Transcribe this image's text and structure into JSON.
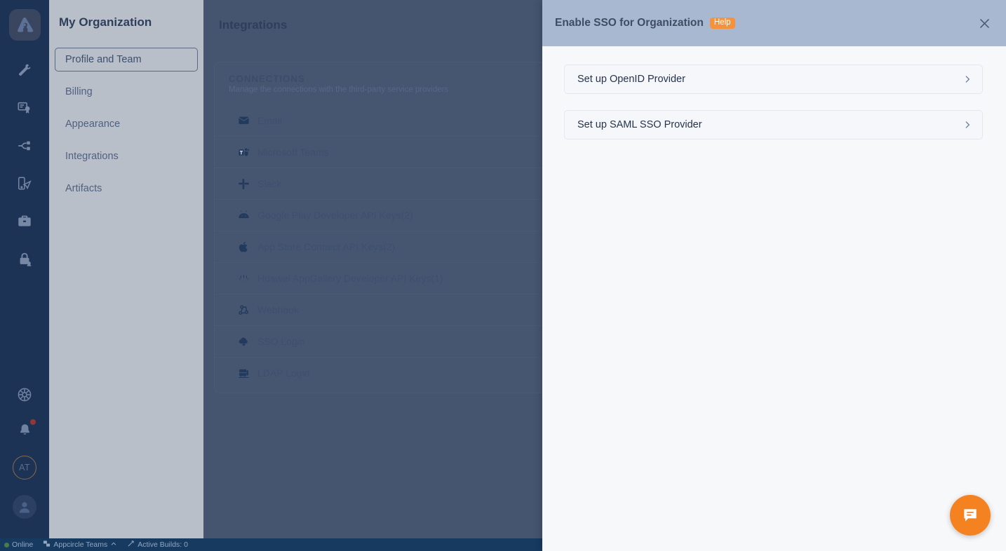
{
  "rail": {
    "logo": "appcircle-logo",
    "items": [
      {
        "name": "build-icon",
        "label": "Build"
      },
      {
        "name": "signing-identities-icon",
        "label": "Signing Identities"
      },
      {
        "name": "distribute-icon",
        "label": "Distribute"
      },
      {
        "name": "testing-distribution-icon",
        "label": "Testing Distribution"
      },
      {
        "name": "enterprise-store-icon",
        "label": "Enterprise App Store"
      },
      {
        "name": "publish-lock-icon",
        "label": "Publish"
      }
    ],
    "bottom": [
      {
        "name": "settings-gear-icon",
        "label": "Settings"
      },
      {
        "name": "notifications-bell-icon",
        "label": "Notifications",
        "has_badge": true
      },
      {
        "name": "organization-avatar",
        "label": "AT"
      },
      {
        "name": "user-avatar",
        "label": "Account"
      }
    ]
  },
  "orgnav": {
    "title": "My Organization",
    "items": [
      {
        "label": "Profile and Team",
        "selected": true
      },
      {
        "label": "Billing",
        "selected": false
      },
      {
        "label": "Appearance",
        "selected": false
      },
      {
        "label": "Integrations",
        "selected": false
      },
      {
        "label": "Artifacts",
        "selected": false
      }
    ]
  },
  "content": {
    "title": "Integrations",
    "panel": {
      "heading": "CONNECTIONS",
      "subheading": "Manage the connections with the third-party service providers",
      "rows": [
        {
          "label": "Email",
          "icon": "email-icon"
        },
        {
          "label": "Microsoft Teams",
          "icon": "microsoft-teams-icon"
        },
        {
          "label": "Slack",
          "icon": "slack-icon"
        },
        {
          "label": "Google Play Developer API Keys(2)",
          "icon": "android-icon"
        },
        {
          "label": "App Store Connect API Keys(2)",
          "icon": "apple-icon"
        },
        {
          "label": "Huawei AppGallery Developer API Keys(1)",
          "icon": "huawei-icon"
        },
        {
          "label": "Webhook",
          "icon": "webhook-icon"
        },
        {
          "label": "SSO Login",
          "icon": "sso-cloud-icon"
        },
        {
          "label": "LDAP Login",
          "icon": "ldap-server-icon"
        }
      ]
    }
  },
  "statusbar": {
    "online": "Online",
    "team": "Appcircle Teams",
    "builds": "Active Builds: 0"
  },
  "modal": {
    "title": "Enable SSO for Organization",
    "help_label": "Help",
    "close_icon": "close-icon",
    "options": [
      {
        "label": "Set up OpenID Provider"
      },
      {
        "label": "Set up SAML SSO Provider"
      }
    ]
  },
  "fab": {
    "icon": "chat-support-icon"
  },
  "colors": {
    "accent_orange": "#f58220",
    "help_badge": "#f5923e",
    "rail_bg": "#1d3356",
    "modal_header": "#a8b8d0",
    "content_bg": "#45546f",
    "statusbar_bg": "#173a61"
  }
}
